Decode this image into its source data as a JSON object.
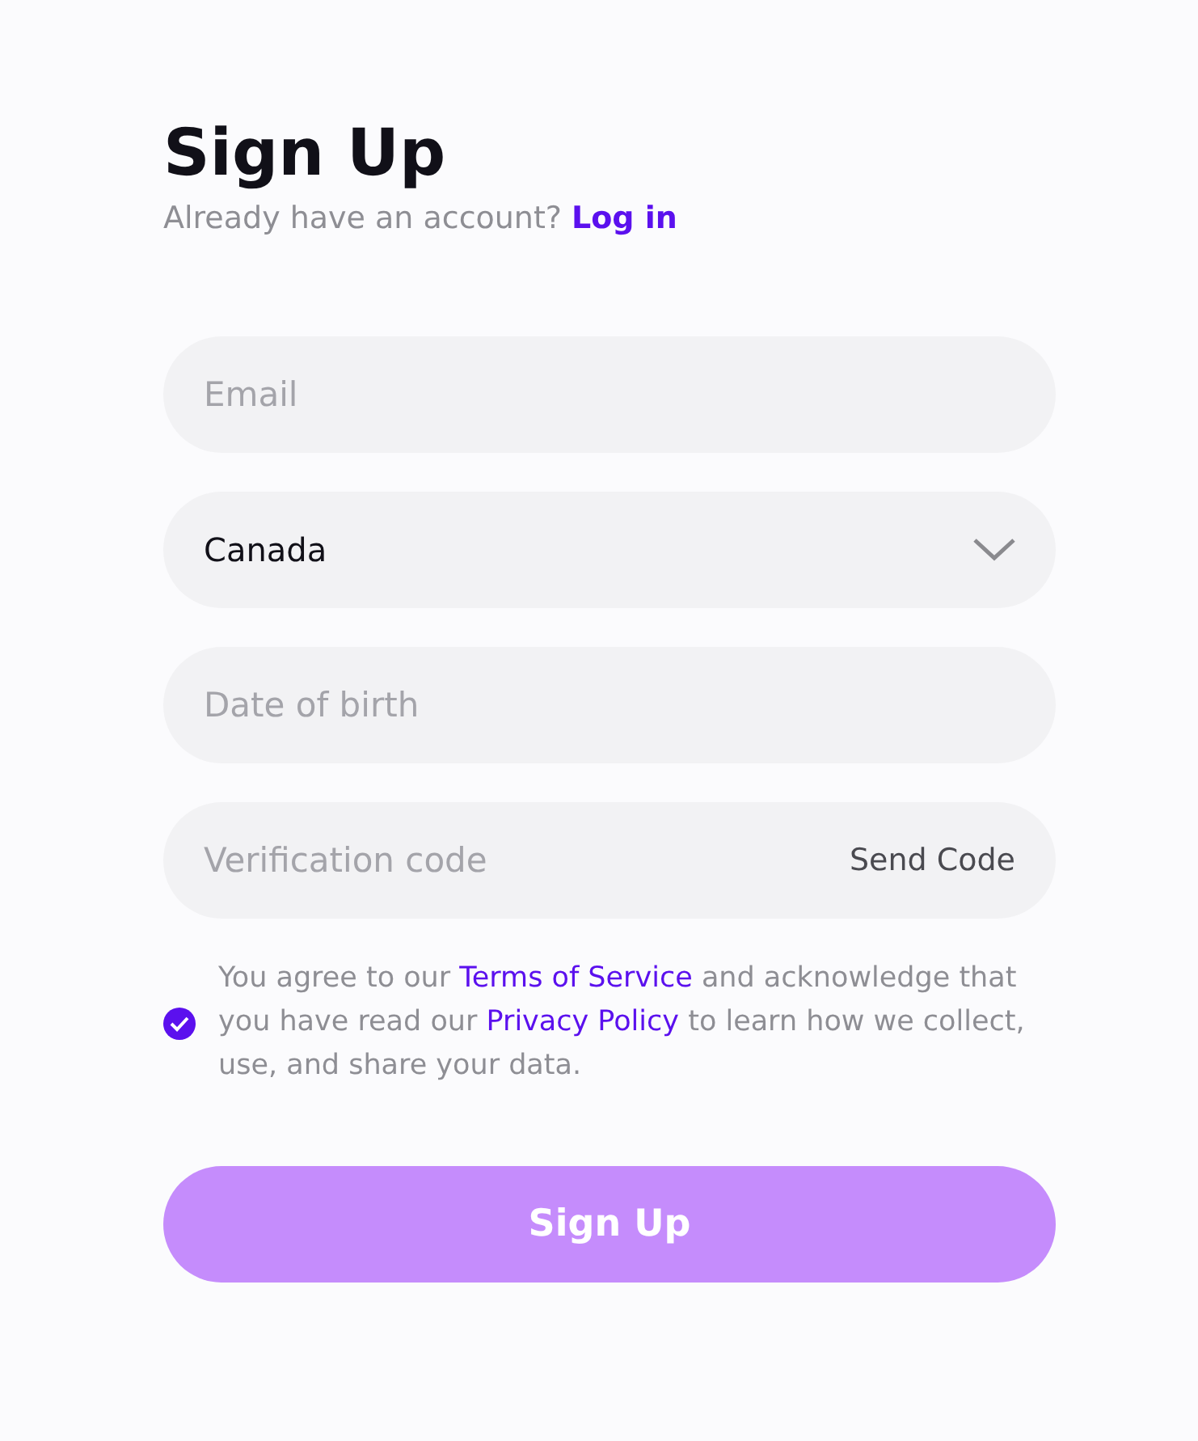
{
  "title": "Sign Up",
  "subtitle": {
    "text": "Already have an account?",
    "link": "Log in"
  },
  "fields": [
    {
      "kind": "input",
      "placeholder": "Email"
    },
    {
      "kind": "select",
      "value": "Canada"
    },
    {
      "kind": "input",
      "placeholder": "Date of birth"
    },
    {
      "kind": "code",
      "placeholder": "Verification code",
      "action": "Send Code"
    }
  ],
  "agreement": {
    "checked": true,
    "parts": [
      {
        "kind": "text",
        "text": "You agree to our "
      },
      {
        "kind": "link",
        "text": "Terms of Service"
      },
      {
        "kind": "text",
        "text": " and acknowledge that you have read our "
      },
      {
        "kind": "link",
        "text": "Privacy Policy"
      },
      {
        "kind": "text",
        "text": " to learn how we collect, use, and share your data."
      }
    ]
  },
  "submit": {
    "label": "Sign Up",
    "disabled": true
  }
}
